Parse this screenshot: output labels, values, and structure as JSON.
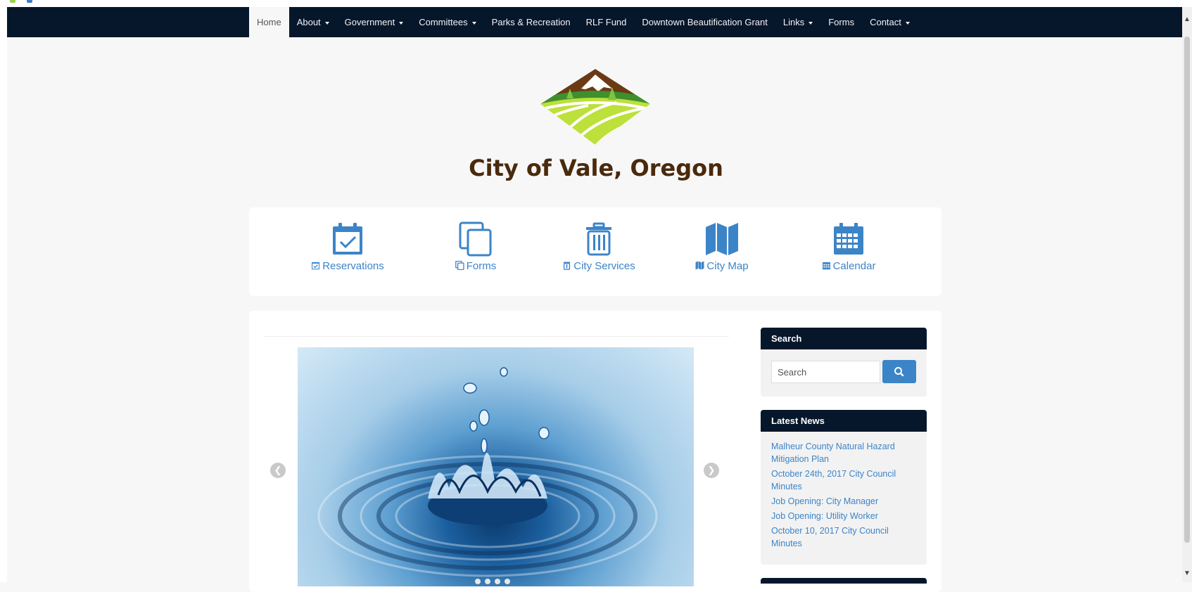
{
  "nav": {
    "items": [
      {
        "label": "Home",
        "active": true,
        "dropdown": false
      },
      {
        "label": "About",
        "active": false,
        "dropdown": true
      },
      {
        "label": "Government",
        "active": false,
        "dropdown": true
      },
      {
        "label": "Committees",
        "active": false,
        "dropdown": true
      },
      {
        "label": "Parks & Recreation",
        "active": false,
        "dropdown": false
      },
      {
        "label": "RLF Fund",
        "active": false,
        "dropdown": false
      },
      {
        "label": "Downtown Beautification Grant",
        "active": false,
        "dropdown": false
      },
      {
        "label": "Links",
        "active": false,
        "dropdown": true
      },
      {
        "label": "Forms",
        "active": false,
        "dropdown": false
      },
      {
        "label": "Contact",
        "active": false,
        "dropdown": true
      }
    ]
  },
  "header": {
    "title": "City of Vale, Oregon"
  },
  "quick_links": [
    {
      "label": "Reservations",
      "icon": "calendar-check-icon"
    },
    {
      "label": "Forms",
      "icon": "copy-icon"
    },
    {
      "label": "City Services",
      "icon": "trash-icon"
    },
    {
      "label": "City Map",
      "icon": "map-icon"
    },
    {
      "label": "Calendar",
      "icon": "calendar-icon"
    }
  ],
  "search": {
    "heading": "Search",
    "placeholder": "Search",
    "button_icon": "search-icon"
  },
  "news": {
    "heading": "Latest News",
    "items": [
      "Malheur County Natural Hazard Mitigation Plan",
      "October 24th, 2017 City Council Minutes",
      "Job Opening: City Manager",
      "Job Opening: Utility Worker",
      "October 10, 2017 City Council Minutes"
    ]
  },
  "colors": {
    "navbar": "#06162b",
    "accent": "#3c84c8",
    "title": "#4a2a0c",
    "page_bg": "#f7f7f7"
  },
  "slider": {
    "image": "water-drop-splash",
    "dot_count": 4
  }
}
